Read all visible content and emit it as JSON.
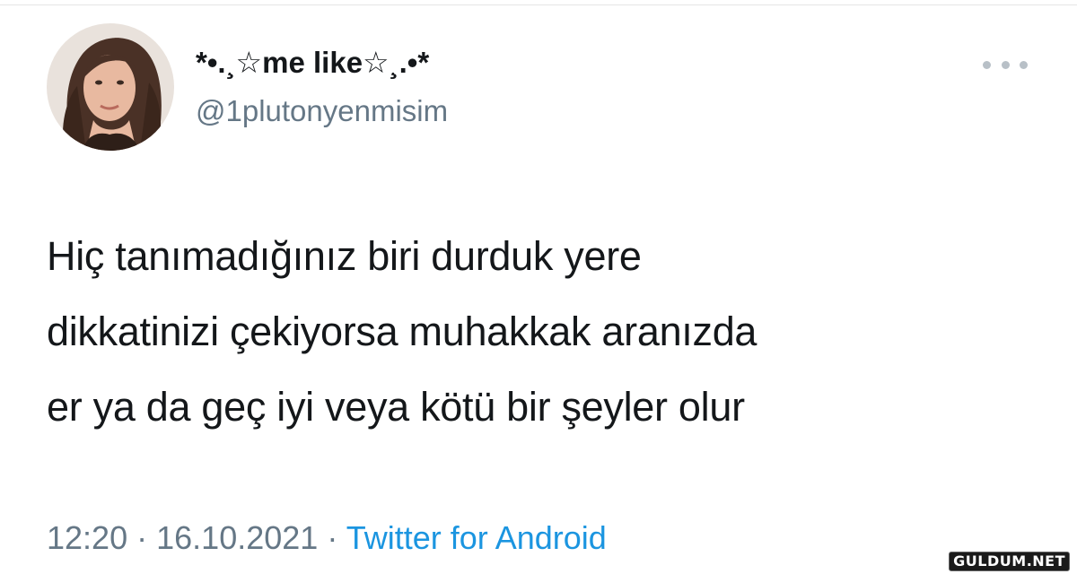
{
  "user": {
    "display_name": "*•.¸☆me like☆¸.•*",
    "handle": "@1plutonyenmisim",
    "avatar_icon": "profile-photo"
  },
  "tweet": {
    "lines": [
      "Hiç tanımadığınız biri durduk yere",
      "dikkatinizi çekiyorsa muhakkak aranızda",
      "er ya da geç iyi veya kötü bir şeyler olur"
    ]
  },
  "meta": {
    "time": "12:20",
    "separator": "·",
    "date": "16.10.2021",
    "source": "Twitter for Android"
  },
  "menu": {
    "icon": "more-options-icon"
  },
  "watermark": {
    "text": "GULDUM.NET"
  },
  "colors": {
    "text": "#14171a",
    "secondary": "#657786",
    "link": "#1b95e0"
  }
}
